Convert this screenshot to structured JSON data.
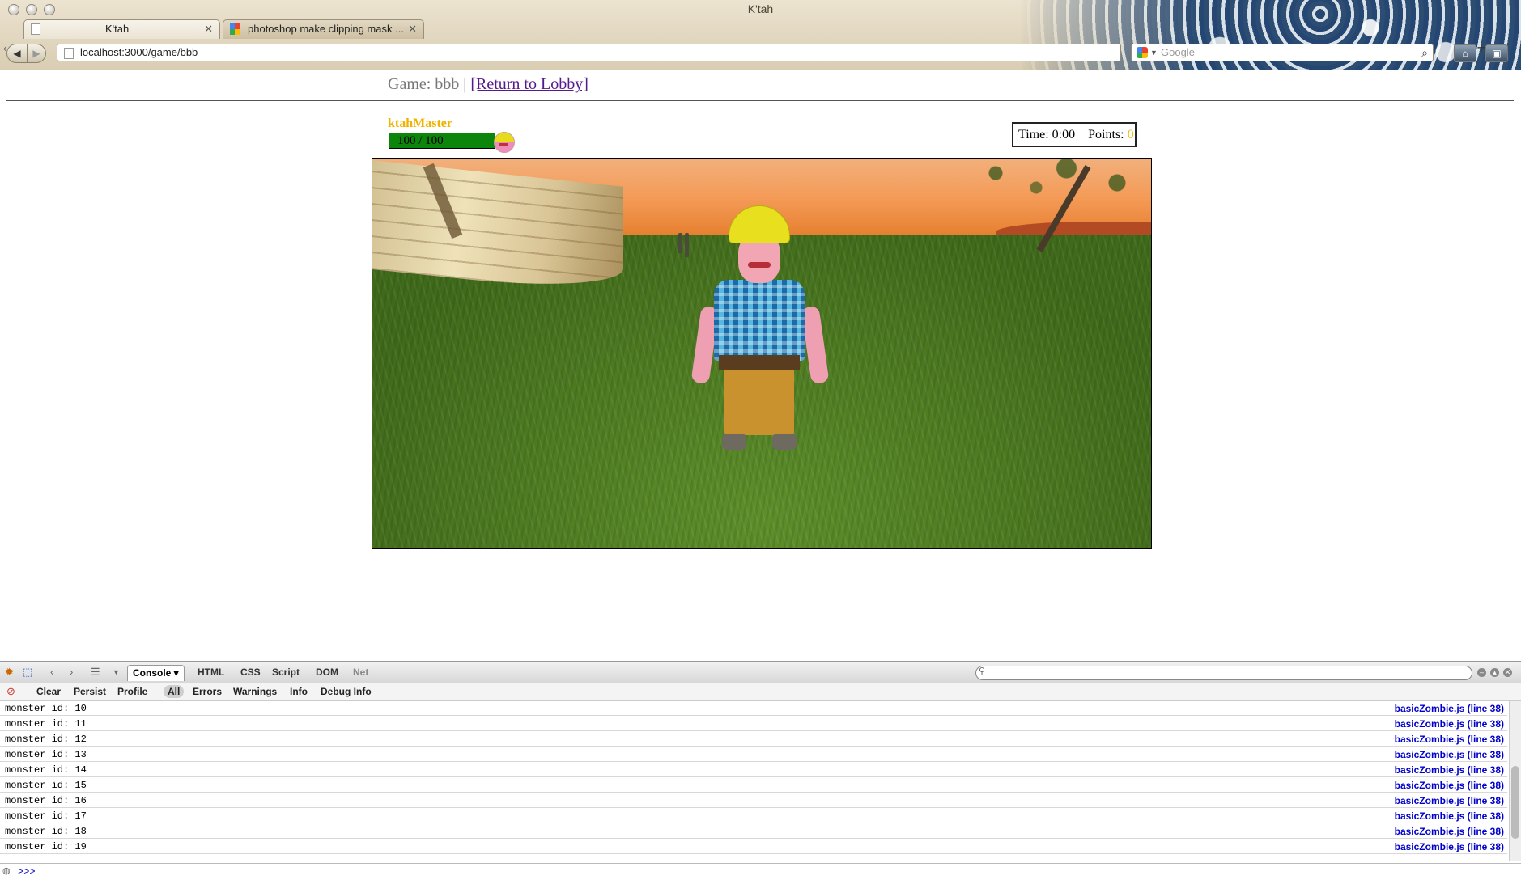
{
  "window": {
    "title": "K'tah"
  },
  "tabs": [
    {
      "label": "K'tah",
      "active": true
    },
    {
      "label": "photoshop make clipping mask ...",
      "active": false
    }
  ],
  "toolbar": {
    "url": "localhost:3000/game/bbb",
    "search_placeholder": "Google"
  },
  "page": {
    "game_prefix": "Game: bbb | ",
    "return_link": "[Return to Lobby]",
    "player": {
      "name": "ktahMaster",
      "health_text": "100 / 100",
      "health_fraction": 1.0
    },
    "stats": {
      "time_label": "Time: 0:00",
      "points_label": "Points:",
      "points_value": "0"
    }
  },
  "firebug": {
    "tabs": [
      "Console",
      "HTML",
      "CSS",
      "Script",
      "DOM",
      "Net"
    ],
    "filters": [
      "Clear",
      "Persist",
      "Profile",
      "All",
      "Errors",
      "Warnings",
      "Info",
      "Debug Info"
    ],
    "log": [
      {
        "msg": "monster id: 10",
        "src": "basicZombie.js (line 38)"
      },
      {
        "msg": "monster id: 11",
        "src": "basicZombie.js (line 38)"
      },
      {
        "msg": "monster id: 12",
        "src": "basicZombie.js (line 38)"
      },
      {
        "msg": "monster id: 13",
        "src": "basicZombie.js (line 38)"
      },
      {
        "msg": "monster id: 14",
        "src": "basicZombie.js (line 38)"
      },
      {
        "msg": "monster id: 15",
        "src": "basicZombie.js (line 38)"
      },
      {
        "msg": "monster id: 16",
        "src": "basicZombie.js (line 38)"
      },
      {
        "msg": "monster id: 17",
        "src": "basicZombie.js (line 38)"
      },
      {
        "msg": "monster id: 18",
        "src": "basicZombie.js (line 38)"
      },
      {
        "msg": "monster id: 19",
        "src": "basicZombie.js (line 38)"
      }
    ],
    "prompt": ">>>"
  }
}
